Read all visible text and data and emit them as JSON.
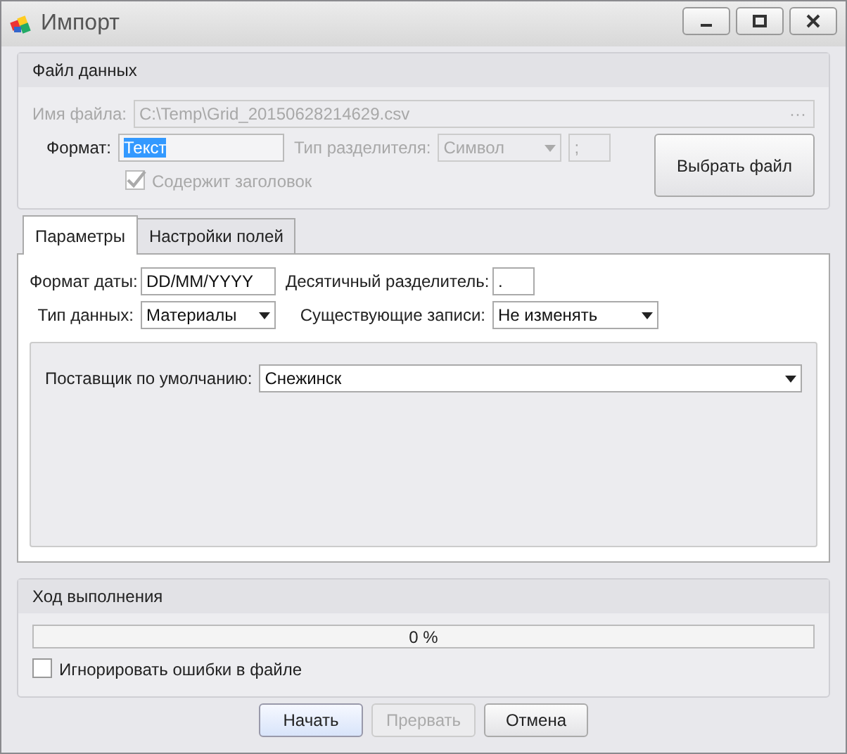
{
  "window": {
    "title": "Импорт"
  },
  "file_group": {
    "title": "Файл данных",
    "file_name": {
      "label": "Имя файла:",
      "value": "C:\\Temp\\Grid_20150628214629.csv",
      "disabled": true,
      "browse": "···"
    },
    "format": {
      "label": "Формат:",
      "value": "Текст",
      "highlighted": true
    },
    "delimiter_type": {
      "label": "Тип разделителя:",
      "value": "Символ",
      "disabled": true
    },
    "delimiter": {
      "value": ";",
      "disabled": true
    },
    "has_header": {
      "label": "Содержит заголовок",
      "checked": true,
      "disabled": true
    },
    "choose_button": "Выбрать файл"
  },
  "tabs": [
    {
      "label": "Параметры",
      "selected": true
    },
    {
      "label": "Настройки полей",
      "selected": false
    }
  ],
  "params": {
    "date_format": {
      "label": "Формат даты:",
      "value": "DD/MM/YYYY"
    },
    "decimal_separator": {
      "label": "Десятичный разделитель:",
      "value": "."
    },
    "data_type": {
      "label": "Тип данных:",
      "value": "Материалы"
    },
    "existing_records": {
      "label": "Существующие записи:",
      "value": "Не изменять"
    },
    "default_supplier": {
      "label": "Поставщик по умолчанию:",
      "value": "Снежинск"
    }
  },
  "progress": {
    "title": "Ход выполнения",
    "level": 0,
    "reading": "0 %"
  },
  "ignore_errors": {
    "label": "Игнорировать ошибки в файле",
    "checked": false
  },
  "buttons": [
    {
      "label": "Начать",
      "disabled": false,
      "default": true
    },
    {
      "label": "Прервать",
      "disabled": true,
      "default": false
    },
    {
      "label": "Отмена",
      "disabled": false,
      "default": false
    }
  ]
}
